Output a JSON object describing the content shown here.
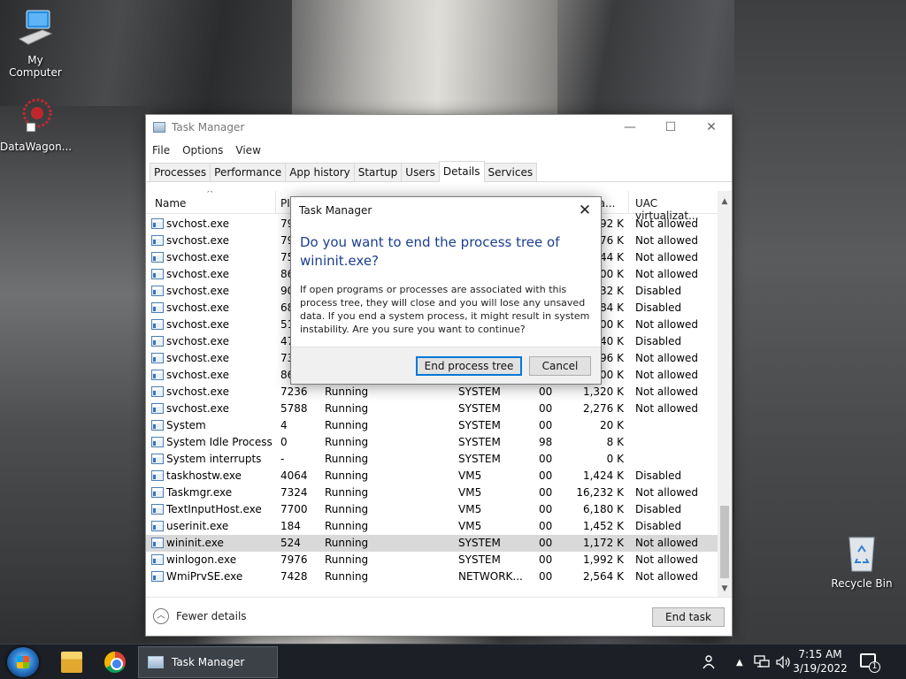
{
  "desktop": {
    "icons": [
      {
        "label": "My Computer"
      },
      {
        "label": "DataWagon..."
      },
      {
        "label": "Recycle Bin"
      }
    ]
  },
  "task_manager": {
    "title": "Task Manager",
    "menu": [
      "File",
      "Options",
      "View"
    ],
    "tabs": [
      "Processes",
      "Performance",
      "App history",
      "Startup",
      "Users",
      "Details",
      "Services"
    ],
    "active_tab": "Details",
    "columns": {
      "name": "Name",
      "pid": "PI",
      "memory": "y (a...",
      "uac": "UAC virtualizat..."
    },
    "rows": [
      {
        "name": "svchost.exe",
        "pid": "79",
        "status": "",
        "user": "",
        "cpu": "",
        "mem": "92 K",
        "uac": "Not allowed"
      },
      {
        "name": "svchost.exe",
        "pid": "79",
        "status": "",
        "user": "",
        "cpu": "",
        "mem": "76 K",
        "uac": "Not allowed"
      },
      {
        "name": "svchost.exe",
        "pid": "75",
        "status": "",
        "user": "",
        "cpu": "",
        "mem": "44 K",
        "uac": "Not allowed"
      },
      {
        "name": "svchost.exe",
        "pid": "86",
        "status": "",
        "user": "",
        "cpu": "",
        "mem": "00 K",
        "uac": "Not allowed"
      },
      {
        "name": "svchost.exe",
        "pid": "90",
        "status": "",
        "user": "",
        "cpu": "",
        "mem": "32 K",
        "uac": "Disabled"
      },
      {
        "name": "svchost.exe",
        "pid": "68",
        "status": "",
        "user": "",
        "cpu": "",
        "mem": "84 K",
        "uac": "Disabled"
      },
      {
        "name": "svchost.exe",
        "pid": "51",
        "status": "",
        "user": "",
        "cpu": "",
        "mem": "00 K",
        "uac": "Not allowed"
      },
      {
        "name": "svchost.exe",
        "pid": "47",
        "status": "",
        "user": "",
        "cpu": "",
        "mem": "40 K",
        "uac": "Disabled"
      },
      {
        "name": "svchost.exe",
        "pid": "73",
        "status": "",
        "user": "",
        "cpu": "",
        "mem": "96 K",
        "uac": "Not allowed"
      },
      {
        "name": "svchost.exe",
        "pid": "86",
        "status": "",
        "user": "",
        "cpu": "",
        "mem": "00 K",
        "uac": "Not allowed"
      },
      {
        "name": "svchost.exe",
        "pid": "7236",
        "status": "Running",
        "user": "SYSTEM",
        "cpu": "00",
        "mem": "1,320 K",
        "uac": "Not allowed"
      },
      {
        "name": "svchost.exe",
        "pid": "5788",
        "status": "Running",
        "user": "SYSTEM",
        "cpu": "00",
        "mem": "2,276 K",
        "uac": "Not allowed"
      },
      {
        "name": "System",
        "pid": "4",
        "status": "Running",
        "user": "SYSTEM",
        "cpu": "00",
        "mem": "20 K",
        "uac": ""
      },
      {
        "name": "System Idle Process",
        "pid": "0",
        "status": "Running",
        "user": "SYSTEM",
        "cpu": "98",
        "mem": "8 K",
        "uac": ""
      },
      {
        "name": "System interrupts",
        "pid": "-",
        "status": "Running",
        "user": "SYSTEM",
        "cpu": "00",
        "mem": "0 K",
        "uac": ""
      },
      {
        "name": "taskhostw.exe",
        "pid": "4064",
        "status": "Running",
        "user": "VM5",
        "cpu": "00",
        "mem": "1,424 K",
        "uac": "Disabled"
      },
      {
        "name": "Taskmgr.exe",
        "pid": "7324",
        "status": "Running",
        "user": "VM5",
        "cpu": "00",
        "mem": "16,232 K",
        "uac": "Not allowed"
      },
      {
        "name": "TextInputHost.exe",
        "pid": "7700",
        "status": "Running",
        "user": "VM5",
        "cpu": "00",
        "mem": "6,180 K",
        "uac": "Disabled"
      },
      {
        "name": "userinit.exe",
        "pid": "184",
        "status": "Running",
        "user": "VM5",
        "cpu": "00",
        "mem": "1,452 K",
        "uac": "Disabled"
      },
      {
        "name": "wininit.exe",
        "pid": "524",
        "status": "Running",
        "user": "SYSTEM",
        "cpu": "00",
        "mem": "1,172 K",
        "uac": "Not allowed"
      },
      {
        "name": "winlogon.exe",
        "pid": "7976",
        "status": "Running",
        "user": "SYSTEM",
        "cpu": "00",
        "mem": "1,992 K",
        "uac": "Not allowed"
      },
      {
        "name": "WmiPrvSE.exe",
        "pid": "7428",
        "status": "Running",
        "user": "NETWORK...",
        "cpu": "00",
        "mem": "2,564 K",
        "uac": "Not allowed"
      }
    ],
    "selected_row": 19,
    "fewer_details": "Fewer details",
    "end_task": "End task"
  },
  "dialog": {
    "title": "Task Manager",
    "heading": "Do you want to end the process tree of wininit.exe?",
    "body": "If open programs or processes are associated with this process tree, they will close and you will lose any unsaved data. If you end a system process, it might result in system instability. Are you sure you want to continue?",
    "primary_button": "End process tree",
    "cancel_button": "Cancel"
  },
  "taskbar": {
    "active_app": "Task Manager",
    "time": "7:15 AM",
    "date": "3/19/2022",
    "notification_count": "1"
  },
  "colors": {
    "dialog_heading": "#1a3f8f",
    "focus_border": "#0078d7",
    "selected_row": "#d9d9d9",
    "taskbar": "#1c2026"
  }
}
